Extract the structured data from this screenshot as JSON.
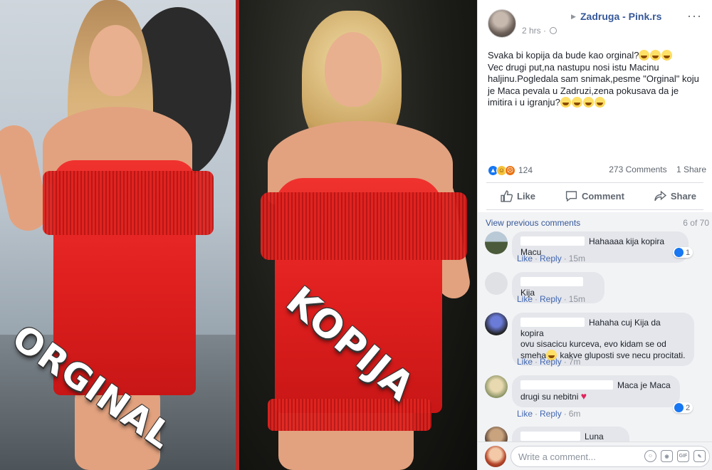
{
  "post": {
    "page_name": "Zadruga - Pink.rs",
    "time": "2 hrs",
    "meta_separator": "·",
    "text": "Svaka bi kopija da bude kao orginal?",
    "text_2": "Vec drugi put,na nastupu nosi istu Macinu haljinu.Pogledala sam snimak,pesme \"Orginal\" koju je Maca pevala u Zadruzi,zena pokusava da je imitira i u igranju?",
    "reaction_count": "124",
    "comments_count": "273 Comments",
    "shares_count": "1 Share"
  },
  "image": {
    "left_label": "ORGINAL",
    "right_label": "KOPIJA"
  },
  "actions": {
    "like": "Like",
    "comment": "Comment",
    "share": "Share"
  },
  "comments_section": {
    "view_previous": "View previous comments",
    "page_count": "6 of 70",
    "like_label": "Like",
    "reply_label": "Reply",
    "items": [
      {
        "text": "Hahaaaa kija kopira Macu",
        "time": "15m",
        "reactions": "1"
      },
      {
        "text": "Kija",
        "time": "15m"
      },
      {
        "text_1": "Hahaha cuj Kija da kopira",
        "text_2": "ovu sisacicu kurceva, evo kidam se od",
        "text_3": "smeha",
        "text_4": " kakve gluposti sve necu procitati.",
        "time": "7m"
      },
      {
        "text_1": "Maca je Maca",
        "text_2": "drugi su nebitni",
        "time": "6m",
        "reactions": "2"
      },
      {
        "text": "Luna krade"
      }
    ]
  },
  "write_comment": {
    "placeholder": "Write a comment...",
    "gif_label": "GIF"
  },
  "colors": {
    "link": "#365899",
    "like_blue": "#1877f2",
    "dress_red": "#e0201f",
    "divider_red": "#b32424"
  }
}
